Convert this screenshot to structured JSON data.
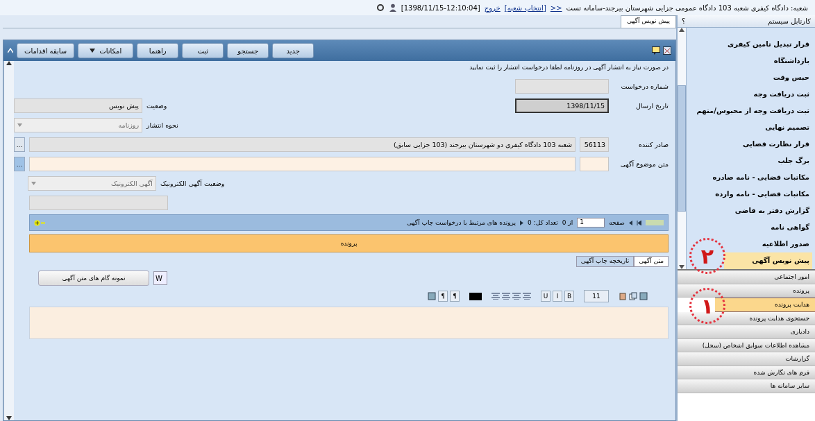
{
  "header": {
    "branch": "شعبه: دادگاه کیفری شعبه 103 دادگاه عمومی جزایی شهرستان بیرجند-سامانه تست",
    "back": "<<",
    "links": [
      {
        "label": "[انتخاب شعبه]"
      },
      {
        "label": "خروج"
      }
    ],
    "datetime": "[1398/11/15-12:10:04]"
  },
  "sidebar": {
    "title": "کارتابل سیستم",
    "help": "؟",
    "items": [
      {
        "label": "قرار تبدیل تامین کیفری",
        "selected": false
      },
      {
        "label": "بازداشتگاه",
        "selected": false
      },
      {
        "label": "حبس وقت",
        "selected": false
      },
      {
        "label": "ثبت دریافت وجه",
        "selected": false
      },
      {
        "label": "ثبت دریافت وجه از محبوس/متهم",
        "selected": false
      },
      {
        "label": "تصمیم نهایی",
        "selected": false
      },
      {
        "label": "قرار نظارت قضایی",
        "selected": false
      },
      {
        "label": "برگ جلب",
        "selected": false
      },
      {
        "label": "مکاتبات قضایی - نامه صادره",
        "selected": false
      },
      {
        "label": "مکاتبات قضایی - نامه وارده",
        "selected": false
      },
      {
        "label": "گزارش دفتر به قاضی",
        "selected": false
      },
      {
        "label": "گواهی نامه",
        "selected": false
      },
      {
        "label": "صدور اطلاعیه",
        "selected": false
      },
      {
        "label": "پیش نویس آگهی",
        "selected": true
      }
    ],
    "modules": [
      {
        "label": "امور اجتماعی",
        "selected": false
      },
      {
        "label": "پرونده",
        "selected": false
      },
      {
        "label": "هدایت پرونده",
        "selected": true
      },
      {
        "label": "جستجوی هدایت پرونده",
        "selected": false
      },
      {
        "label": "دادیاری",
        "selected": false
      },
      {
        "label": "مشاهده اطلاعات سوابق اشخاص (سجل)",
        "selected": false
      },
      {
        "label": "گزارشات",
        "selected": false
      },
      {
        "label": "فرم های نگارش شده",
        "selected": false
      },
      {
        "label": "سایر سامانه ها",
        "selected": false
      }
    ]
  },
  "annotations": [
    {
      "label": "۲"
    },
    {
      "label": "۱"
    }
  ],
  "tabs": [
    {
      "label": "پیش نویس آگهی",
      "selected": true
    }
  ],
  "toolbar": [
    {
      "label": "جدید",
      "kind": "button"
    },
    {
      "label": "جستجو",
      "kind": "button"
    },
    {
      "label": "ثبت",
      "kind": "button"
    },
    {
      "label": "راهنما",
      "kind": "button"
    },
    {
      "label": "امکانات",
      "kind": "dropdown"
    },
    {
      "label": "سابقه اقدامات",
      "kind": "button"
    }
  ],
  "notice": "در صورت نیاز به انتشار آگهی در روزنامه لطفا درخواست انتشار را ثبت نمایید",
  "form": {
    "request_number": {
      "label": "شماره درخواست"
    },
    "send_date": {
      "label": "تاریخ ارسال",
      "value": "1398/11/15"
    },
    "status": {
      "label": "وضعیت",
      "value": "پیش نویس"
    },
    "publish_type": {
      "label": "نحوه انتشار",
      "value": "روزنامه"
    },
    "issuer": {
      "label": "صادر کننده",
      "code": "56113",
      "value": "شعبه 103 دادگاه کیفری دو شهرستان بیرجند (103 جزایی سابق)",
      "button": "..."
    },
    "subject": {
      "label": "متن موضوع آگهی",
      "button": "..."
    },
    "electronic": {
      "label": "وضعیت آگهی الکترونیک",
      "value": "آگهی الکترونیک"
    }
  },
  "grid": {
    "title": "پرونده های مرتبط با درخواست چاپ آگهی",
    "page_label": "صفحه",
    "page": "1",
    "of": "از 0",
    "total": "تعداد کل: 0",
    "columns": [
      "پرونده"
    ]
  },
  "subtabs": [
    {
      "label": "متن آگهی",
      "selected": true
    },
    {
      "label": "تاریخچه چاپ آگهی",
      "selected": false
    }
  ],
  "template": {
    "w": "W",
    "label": "نمونه گام های متن آگهی"
  },
  "editor": {
    "buttons": [
      {
        "kind": "icon"
      },
      {
        "kind": "icon"
      },
      {
        "kind": "icon"
      },
      {
        "kind": "sep"
      },
      {
        "kind": "select",
        "label": "11"
      },
      {
        "kind": "sep"
      },
      {
        "kind": "text",
        "label": "B"
      },
      {
        "kind": "text",
        "label": "I"
      },
      {
        "kind": "text",
        "label": "U"
      },
      {
        "kind": "sep"
      },
      {
        "kind": "align"
      },
      {
        "kind": "align"
      },
      {
        "kind": "align"
      },
      {
        "kind": "align"
      },
      {
        "kind": "sep"
      },
      {
        "kind": "color"
      },
      {
        "kind": "sep"
      },
      {
        "kind": "text",
        "label": "¶"
      },
      {
        "kind": "text",
        "label": "¶"
      },
      {
        "kind": "icon"
      }
    ]
  }
}
